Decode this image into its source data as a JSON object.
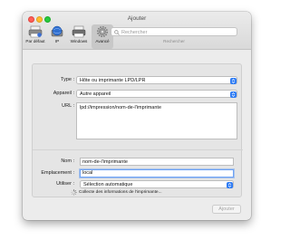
{
  "window": {
    "title": "Ajouter",
    "toolbar": [
      {
        "label": "Par défaut",
        "icon": "printer-default-icon"
      },
      {
        "label": "IP",
        "icon": "globe-ip-icon"
      },
      {
        "label": "Windows",
        "icon": "windows-printer-icon"
      },
      {
        "label": "Avancé",
        "icon": "gear-icon",
        "selected": true
      }
    ],
    "search": {
      "placeholder": "Rechercher",
      "caption": "Rechercher"
    }
  },
  "form": {
    "type_label": "Type :",
    "type_value": "Hôte ou imprimante LPD/LPR",
    "device_label": "Appareil :",
    "device_value": "Autre appareil",
    "url_label": "URL :",
    "url_value": "lpd://impression/nom-de-l'imprimante",
    "name_label": "Nom :",
    "name_value": "nom-de-l'imprimante",
    "location_label": "Emplacement :",
    "location_value": "local",
    "use_label": "Utiliser :",
    "use_value": "Sélection automatique",
    "status_text": "Collecte des informations de l'imprimante..."
  },
  "footer": {
    "add_label": "Ajouter"
  },
  "colors": {
    "accent": "#2d7bf4",
    "focus_ring": "#6fa3f5"
  }
}
